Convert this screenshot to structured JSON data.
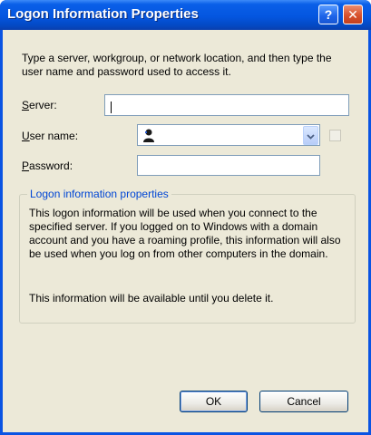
{
  "window": {
    "title": "Logon Information Properties",
    "help_label": "?",
    "close_label": "✕"
  },
  "intro_text": "Type a server, workgroup, or network location, and then type the user name and password used to access it.",
  "fields": {
    "server": {
      "label_key": "S",
      "label_rest": "erver:",
      "value": ""
    },
    "username": {
      "label_key": "U",
      "label_rest": "ser name:",
      "value": ""
    },
    "password": {
      "label_key": "P",
      "label_rest": "assword:",
      "value": ""
    }
  },
  "group": {
    "title": "Logon information properties",
    "body": "This logon information will be used when you connect to the specified server. If you logged on to Windows with a domain account and you have a roaming profile, this information will also be used when you log on from other computers in the domain.",
    "footer": "This information will be available until you delete it."
  },
  "buttons": {
    "ok": "OK",
    "cancel": "Cancel"
  },
  "colors": {
    "titlebar": "#0456e0",
    "dialog_bg": "#ece9d8",
    "group_title": "#0046d5"
  }
}
